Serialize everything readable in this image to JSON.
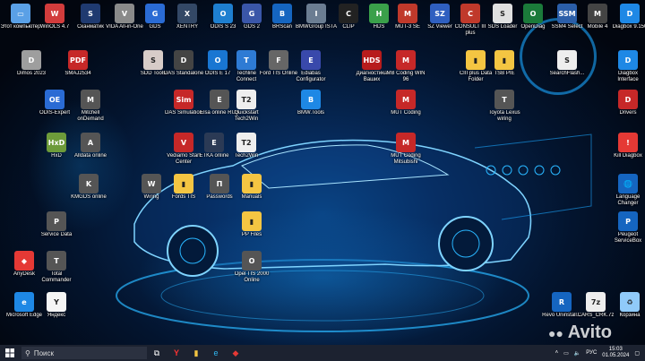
{
  "desktop_icons": [
    {
      "label": "Этот компьютер",
      "icon": "computer-icon",
      "color": "#5aa0e6",
      "glyph": "▭"
    },
    {
      "label": "WinOLS 4.7",
      "icon": "winols-icon",
      "color": "#d23c3c",
      "glyph": "W"
    },
    {
      "label": "Сканматик",
      "icon": "scanmatik-icon",
      "color": "#1f3a70",
      "glyph": "S"
    },
    {
      "label": "VIDA All-in-One",
      "icon": "vida-icon",
      "color": "#8a8a8a",
      "glyph": "V"
    },
    {
      "label": "GDS",
      "icon": "gds-icon",
      "color": "#2a6bd4",
      "glyph": "G"
    },
    {
      "label": "XENTRY",
      "icon": "xentry-icon",
      "color": "#334866",
      "glyph": "X"
    },
    {
      "label": "ODIS S 23",
      "icon": "odis-s-icon",
      "color": "#1e7fd0",
      "glyph": "O"
    },
    {
      "label": "GDS 2",
      "icon": "gds2-icon",
      "color": "#3a56a8",
      "glyph": "G"
    },
    {
      "label": "BRScan",
      "icon": "brscan-icon",
      "color": "#1565c0",
      "glyph": "B"
    },
    {
      "label": "BMWGroup ISTA",
      "icon": "ista-icon",
      "color": "#6b7d92",
      "glyph": "I"
    },
    {
      "label": "CLIP",
      "icon": "clip-icon",
      "color": "#222222",
      "glyph": "C"
    },
    {
      "label": "HDS",
      "icon": "hds-icon",
      "color": "#3aa04a",
      "glyph": "H"
    },
    {
      "label": "MUT-3 SE",
      "icon": "mut3-icon",
      "color": "#c0392b",
      "glyph": "M"
    },
    {
      "label": "SZ Viewer",
      "icon": "sz-icon",
      "color": "#2f5fc0",
      "glyph": "SZ"
    },
    {
      "label": "CONSULT III plus",
      "icon": "consult-icon",
      "color": "#c0392b",
      "glyph": "C"
    },
    {
      "label": "SDS Loader",
      "icon": "sds-icon",
      "color": "#e0e0e0",
      "glyph": "S"
    },
    {
      "label": "OpenDiag",
      "icon": "opendiag-icon",
      "color": "#1b7a3a",
      "glyph": "O"
    },
    {
      "label": "SSM4 Select",
      "icon": "ssm4-icon",
      "color": "#2b5ea8",
      "glyph": "SSM"
    },
    {
      "label": "Mobile 4",
      "icon": "mobile-icon",
      "color": "#444444",
      "glyph": "M"
    },
    {
      "label": "Diagbox 9.150",
      "icon": "diagbox-icon",
      "color": "#1e88e5",
      "glyph": "D"
    },
    {
      "label": "Dimos 2023",
      "icon": "dimos-icon",
      "color": "#9e9e9e",
      "glyph": "D"
    },
    {
      "label": "SMAJ2534",
      "icon": "smaj-icon",
      "color": "#c62828",
      "glyph": "PDF"
    },
    {
      "label": "SDD Tools",
      "icon": "sdd-icon",
      "color": "#d7ccc8",
      "glyph": "S"
    },
    {
      "label": "DAS Standalone",
      "icon": "das-icon",
      "color": "#444444",
      "glyph": "D"
    },
    {
      "label": "ODIS E 17",
      "icon": "odis-e-icon",
      "color": "#1976d2",
      "glyph": "O"
    },
    {
      "label": "Techline Connect",
      "icon": "techline-icon",
      "color": "#2e7bd4",
      "glyph": "T"
    },
    {
      "label": "Ford TIS Online",
      "icon": "fordtis-icon",
      "color": "#666666",
      "glyph": "F"
    },
    {
      "label": "Ediabas Configurator",
      "icon": "ediabas-icon",
      "color": "#3949ab",
      "glyph": "E"
    },
    {
      "label": "Диагностика Ваших",
      "icon": "diag-icon",
      "color": "#b71c1c",
      "glyph": "HDS"
    },
    {
      "label": "MB Coding WIN 96",
      "icon": "mbcoding-icon",
      "color": "#c62828",
      "glyph": "M"
    },
    {
      "label": "CIII plus Data Folder",
      "icon": "ciii-folder-icon",
      "color": "#f4c542",
      "glyph": "▮"
    },
    {
      "label": "TSB PIE",
      "icon": "tsb-icon",
      "color": "#f4c542",
      "glyph": "▮"
    },
    {
      "label": "SearchFlash...",
      "icon": "searchflash-icon",
      "color": "#eeeeee",
      "glyph": "S"
    },
    {
      "label": "Diagbox Interface",
      "icon": "diagbox-if-icon",
      "color": "#1e88e5",
      "glyph": "D"
    },
    {
      "label": "ODIS-Expert",
      "icon": "odis-expert-icon",
      "color": "#2a6bd4",
      "glyph": "OE"
    },
    {
      "label": "Mitchell onDemand",
      "icon": "mitchell-icon",
      "color": "#555555",
      "glyph": "M"
    },
    {
      "label": "DAS Simulation",
      "icon": "das-sim-icon",
      "color": "#c62828",
      "glyph": "Sim"
    },
    {
      "label": "Elsa online RUS",
      "icon": "elsa-icon",
      "color": "#555555",
      "glyph": "E"
    },
    {
      "label": "Quickstart Tech2Win",
      "icon": "quickstart-icon",
      "color": "#eeeeee",
      "glyph": "T2"
    },
    {
      "label": "BMW.Tools",
      "icon": "bmwtools-icon",
      "color": "#1e88e5",
      "glyph": "B"
    },
    {
      "label": "MUT Coding",
      "icon": "mut-coding-icon",
      "color": "#c62828",
      "glyph": "M"
    },
    {
      "label": "Toyota Lexus wiring",
      "icon": "toyota-icon",
      "color": "#555555",
      "glyph": "T"
    },
    {
      "label": "Drivers",
      "icon": "drivers-icon",
      "color": "#c62828",
      "glyph": "D"
    },
    {
      "label": "HxD",
      "icon": "hxd-icon",
      "color": "#6d9b3a",
      "glyph": "HxD"
    },
    {
      "label": "Alldata online",
      "icon": "alldata-icon",
      "color": "#555555",
      "glyph": "A"
    },
    {
      "label": "Vediamo Start Center",
      "icon": "vediamo-icon",
      "color": "#c62828",
      "glyph": "V"
    },
    {
      "label": "ETKA online",
      "icon": "etka-icon",
      "color": "#2b3a55",
      "glyph": "E"
    },
    {
      "label": "Tech2Win",
      "icon": "tech2win-icon",
      "color": "#eeeeee",
      "glyph": "T2"
    },
    {
      "label": "MUT Coding Mitsubishi",
      "icon": "mut-mitsu-icon",
      "color": "#c62828",
      "glyph": "M"
    },
    {
      "label": "Kill Diagbox",
      "icon": "kill-icon",
      "color": "#e53935",
      "glyph": "!"
    },
    {
      "label": "KMGDS online",
      "icon": "kmgds-icon",
      "color": "#555555",
      "glyph": "K"
    },
    {
      "label": "Wiring",
      "icon": "wiring-icon",
      "color": "#555555",
      "glyph": "W"
    },
    {
      "label": "Fords TIS",
      "icon": "fords-tis-icon",
      "color": "#f4c542",
      "glyph": "▮"
    },
    {
      "label": "Passwords",
      "icon": "passwords-icon",
      "color": "#555555",
      "glyph": "П"
    },
    {
      "label": "Manuals",
      "icon": "manuals-icon",
      "color": "#f4c542",
      "glyph": "▮"
    },
    {
      "label": "Language Changer",
      "icon": "language-icon",
      "color": "#1565c0",
      "glyph": "🌐"
    },
    {
      "label": "Service Data",
      "icon": "servicedata-icon",
      "color": "#555555",
      "glyph": "P"
    },
    {
      "label": "PP Files",
      "icon": "ppfiles-icon",
      "color": "#f4c542",
      "glyph": "▮"
    },
    {
      "label": "Peugeot ServiceBox",
      "icon": "servicebox-icon",
      "color": "#1565c0",
      "glyph": "P"
    },
    {
      "label": "AnyDesk",
      "icon": "anydesk-icon",
      "color": "#e53935",
      "glyph": "◆"
    },
    {
      "label": "Total Commander",
      "icon": "totalcmd-icon",
      "color": "#555555",
      "glyph": "T"
    },
    {
      "label": "Opel TIS 2000 Online",
      "icon": "opel-tis-icon",
      "color": "#555555",
      "glyph": "O"
    },
    {
      "label": "Microsoft Edge",
      "icon": "edge-icon",
      "color": "#1e88e5",
      "glyph": "e"
    },
    {
      "label": "Яндекс",
      "icon": "yandex-icon",
      "color": "#f5f5f5",
      "glyph": "Y"
    },
    {
      "label": "Revo Uninstall...",
      "icon": "revo-icon",
      "color": "#1565c0",
      "glyph": "R"
    },
    {
      "label": "CARS_CRK.7z",
      "icon": "archive-icon",
      "color": "#eeeeee",
      "glyph": "7z"
    },
    {
      "label": "Корзина",
      "icon": "recycle-bin-icon",
      "color": "#90caf9",
      "glyph": "♻"
    }
  ],
  "taskbar": {
    "search_placeholder": "Поиск",
    "language": "РУС",
    "time": "15:03",
    "date": "01.05.2024"
  },
  "watermark": "Avito"
}
